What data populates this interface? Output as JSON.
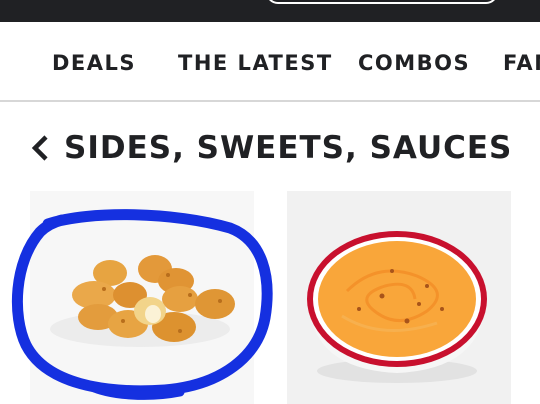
{
  "nav": {
    "items": [
      {
        "label": "DEALS"
      },
      {
        "label": "THE LATEST"
      },
      {
        "label": "COMBOS"
      },
      {
        "label": "FAM"
      }
    ]
  },
  "section": {
    "title": "SIDES, SWEETS, SAUCES"
  },
  "colors": {
    "topbar": "#202124",
    "annotation": "#1530e0",
    "sauce": "#f9a63a",
    "bowl_rim": "#c8102e"
  },
  "icons": {
    "back": "chevron-left-icon"
  },
  "products": [
    {
      "image": "cheese-curds-image"
    },
    {
      "image": "cheese-sauce-image"
    }
  ]
}
